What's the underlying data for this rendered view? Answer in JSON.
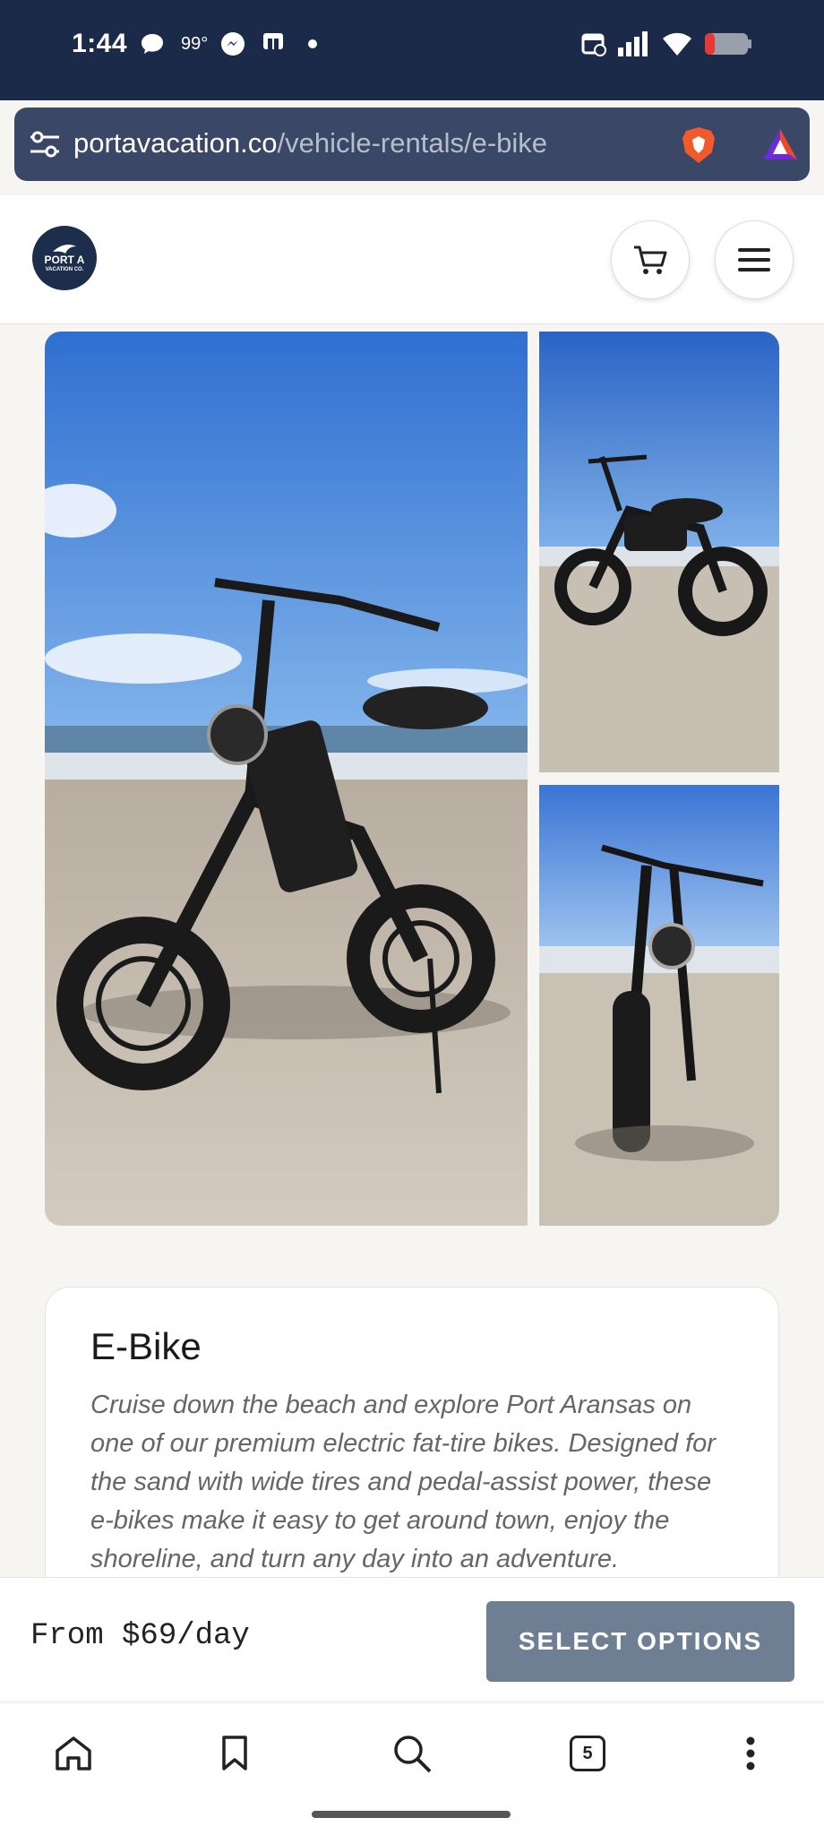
{
  "status_bar": {
    "time": "1:44",
    "temp": "99°"
  },
  "browser": {
    "url_domain": "portavacation.co",
    "url_path": "/vehicle-rentals/e-bike",
    "tab_count": "5"
  },
  "header": {
    "logo_line1": "PORT A",
    "logo_line2": "VACATION CO."
  },
  "product": {
    "title": "E-Bike",
    "description": "Cruise down the beach and explore Port Aransas on one of our premium electric fat-tire bikes. Designed for the sand with wide tires and pedal-assist power, these e-bikes make it easy to get around town, enjoy the shoreline, and turn any day into an adventure."
  },
  "purchase": {
    "price": "From $69/day",
    "select_label": "SELECT OPTIONS"
  },
  "colors": {
    "status_bg": "#1c2a4a",
    "button": "#6e7e93",
    "sky": "#3f7fd8",
    "sand": "#c9c1b4"
  }
}
